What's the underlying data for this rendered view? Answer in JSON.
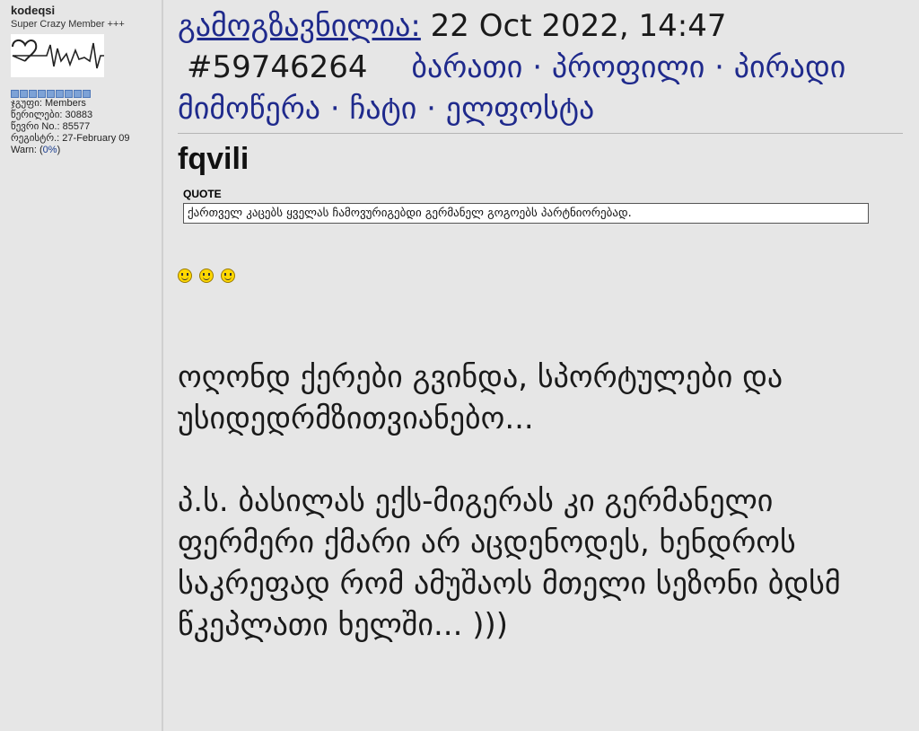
{
  "sidebar": {
    "username": "kodeqsi",
    "member_title": "Super Crazy Member +++",
    "group": "ჯგუფი: Members",
    "posts": "წერილები: 30883",
    "member_no": "წევრი No.: 85577",
    "registered": "რეგისტრ.: 27-February 09",
    "warn_label": "Warn: (",
    "warn_value": "0%",
    "warn_close": ")"
  },
  "header": {
    "sent_label": "გამოგზავნილია:",
    "date": "22 Oct 2022, 14:47",
    "post_number": "#59746264",
    "links": [
      "ბარათი",
      "პროფილი",
      "პირადი მიმოწერა",
      "ჩატი",
      "ელფოსტა"
    ],
    "separator": "·"
  },
  "post": {
    "quoted_author": "fqvili",
    "quote_label": "QUOTE",
    "quote_text": "ქართველ კაცებს ყველას ჩამოვურიგებდი გერმანელ გოგოებს პარტნიორებად.",
    "smileys": [
      "smiley-icon",
      "smiley-icon",
      "smiley-icon"
    ],
    "paragraphs": [
      "ოღონდ ქერები გვინდა, სპორტულები და უსიდედრმზითვიანებო...",
      "პ.ს. ბასილას ექს-მიგერას კი გერმანელი ფერმერი ქმარი არ აცდენოდეს, ხენდროს საკრეფად რომ ამუშაოს მთელი სეზონი ბდსმ წკეპლათი ხელში... )))"
    ]
  },
  "colors": {
    "background": "#e6e6e6",
    "link": "#1f2a8c",
    "pip": "#7da2d6"
  }
}
